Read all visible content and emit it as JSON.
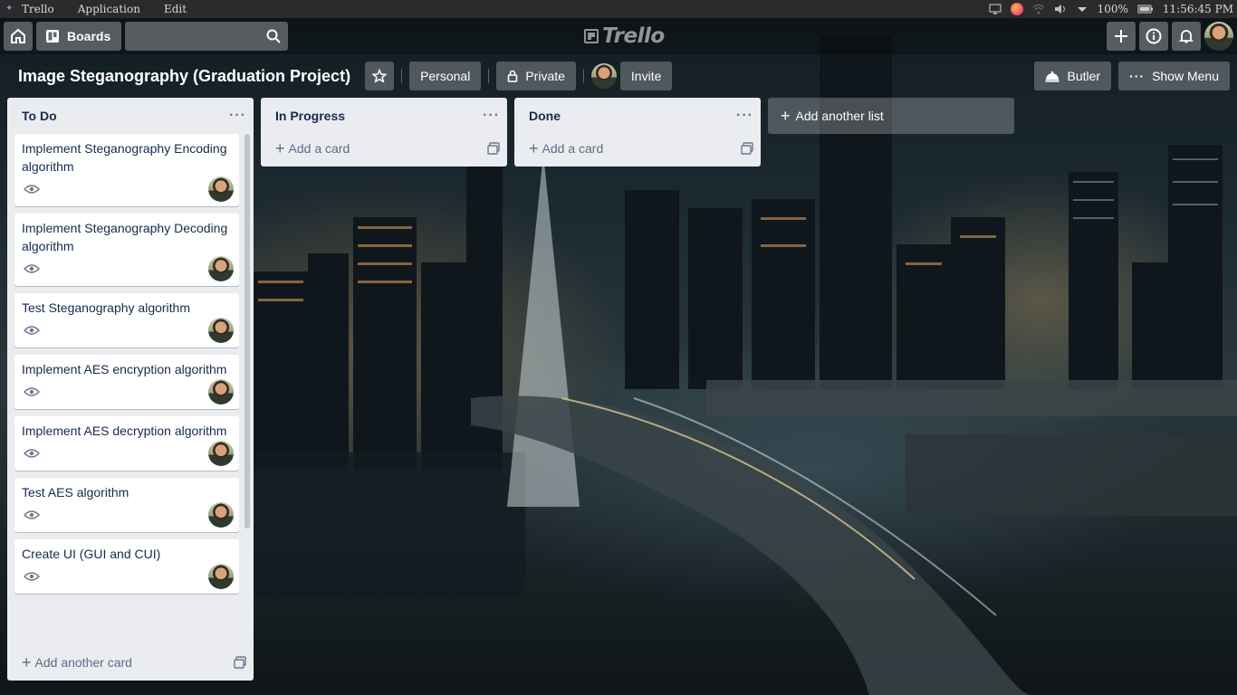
{
  "os": {
    "app_name": "Trello",
    "menus": [
      "Application",
      "Edit"
    ],
    "battery": "100%",
    "time": "11:56:45 PM"
  },
  "header": {
    "boards_label": "Boards",
    "search_placeholder": ""
  },
  "logo": {
    "text": "Trello"
  },
  "board": {
    "title": "Image Steganography (Graduation Project)",
    "visibility_team": "Personal",
    "visibility": "Private",
    "invite_label": "Invite",
    "butler_label": "Butler",
    "show_menu_label": "Show Menu"
  },
  "lists": [
    {
      "title": "To Do",
      "cards": [
        "Implement Steganography Encoding algorithm",
        "Implement Steganography Decoding algorithm",
        "Test Steganography algorithm",
        "Implement AES encryption algorithm",
        "Implement AES decryption algorithm",
        "Test AES algorithm",
        "Create UI (GUI and CUI)"
      ],
      "add_label": "Add another card"
    },
    {
      "title": "In Progress",
      "cards": [],
      "add_label": "Add a card"
    },
    {
      "title": "Done",
      "cards": [],
      "add_label": "Add a card"
    }
  ],
  "add_list_label": "Add another list",
  "icons": {
    "home": "home-icon",
    "boards": "boards-icon",
    "search": "search-icon",
    "create": "plus-icon",
    "info": "info-icon",
    "notifications": "bell-icon",
    "star": "star-icon",
    "lock": "lock-icon",
    "butler": "butler-icon",
    "menu": "ellipsis-icon",
    "watch": "eye-icon",
    "template": "card-template-icon"
  },
  "colors": {
    "list_bg": "#ebecf0",
    "card_bg": "#ffffff",
    "text": "#172b4d",
    "muted": "#5e6c84"
  }
}
